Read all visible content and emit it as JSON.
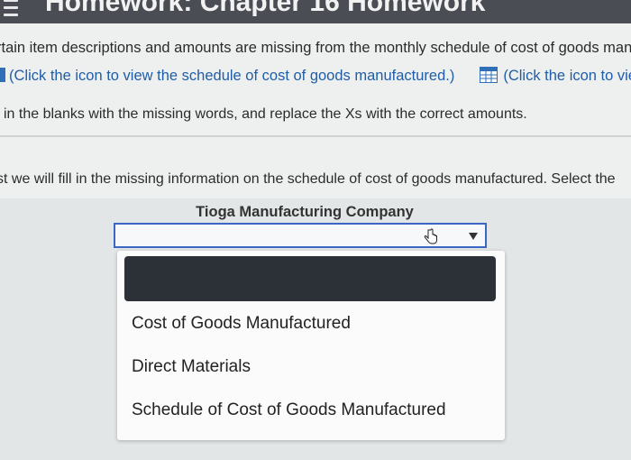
{
  "header": {
    "title": "Homework: Chapter 16 Homework"
  },
  "instructions": {
    "line1": "rtain item descriptions and amounts are missing from the monthly schedule of cost of goods man",
    "line2_link": "(Click the icon to view the schedule of cost of goods manufactured.)",
    "line2_link2": "(Click the icon to vie",
    "line3": " in the blanks with the missing words, and replace the Xs with the correct amounts.",
    "line4": "st we will fill in the missing information on the schedule of cost of goods manufactured. Select the"
  },
  "form": {
    "company": "Tioga Manufacturing Company",
    "select_value": "",
    "options": [
      "",
      "Cost of Goods Manufactured",
      "Direct Materials",
      "Schedule of Cost of Goods Manufactured"
    ]
  },
  "colors": {
    "accent": "#3a66c6",
    "link": "#1f5da8",
    "topbar": "#4a4d53",
    "selected_option": "#2c3137"
  }
}
